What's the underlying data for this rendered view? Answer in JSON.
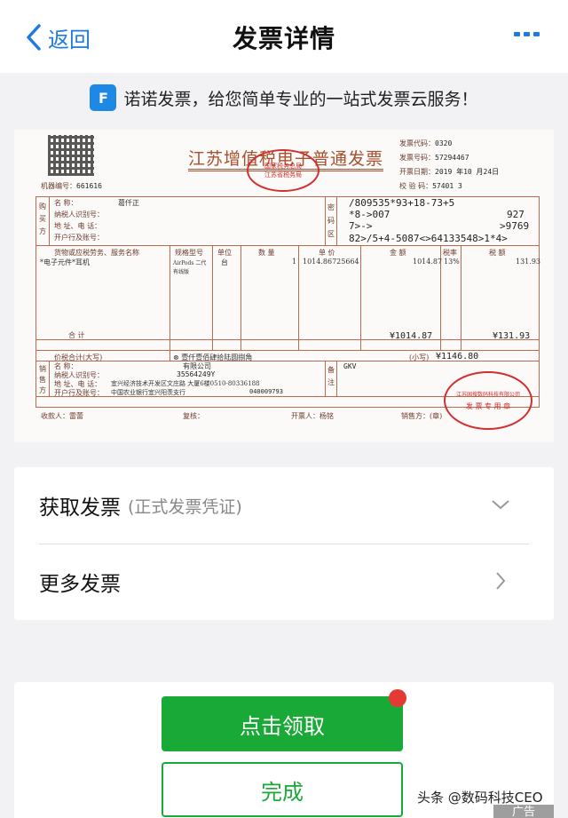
{
  "nav": {
    "back_label": "返回",
    "title": "发票详情"
  },
  "banner": {
    "logo_text": "F",
    "text": "诺诺发票，给您简单专业的一站式发票云服务！"
  },
  "invoice": {
    "title": "江苏增值税电子普通发票",
    "machine_no_label": "机器编号：",
    "machine_no": "661616",
    "invoice_code_label": "发票代码：",
    "invoice_code": "0320",
    "invoice_no_label": "发票号码：",
    "invoice_no": "57294467",
    "issue_date_label": "开票日期：",
    "issue_date": "2019 年10 月24日",
    "check_code_label": "校 验 码：",
    "check_code": "57401 3",
    "stamp_top": "国家税务总局",
    "stamp_bottom": "江苏省税务局",
    "buyer_side": "购买方",
    "buyer_fields": [
      "名      称：",
      "纳税人识别号：",
      "地 址、电 话：",
      "开户行及账号："
    ],
    "buyer_name": "葛仟正",
    "cipher_side": "密码区",
    "cipher_lines": [
      "/809535*93+18-73+5",
      "*8->007",
      "7>->",
      "82>/5+4-5087<>64133548>1*4>"
    ],
    "cipher_right": [
      "927",
      ">9769"
    ],
    "col_headers": [
      "货物或应税劳务、服务名称",
      "规格型号",
      "单位",
      "数 量",
      "单 价",
      "金 额",
      "税率",
      "税 额"
    ],
    "item_name": "*电子元件*耳机",
    "item_spec": "AirPods 二代 有线版",
    "item_unit": "台",
    "item_qty": "1",
    "item_price": "1014.86725664",
    "item_amount": "1014.87",
    "item_rate": "13%",
    "item_tax": "131.93",
    "total_label": "合      计",
    "total_amount": "¥1014.87",
    "total_tax": "¥131.93",
    "grand_label": "价税合计(大写)",
    "grand_words": "壹仟壹佰肆拾陆圆捌角",
    "grand_small_label": "(小写)",
    "grand_value": "¥1146.80",
    "seller_side": "销售方",
    "seller_fields": [
      "名      称：",
      "纳税人识别号：",
      "地 址、电 话：",
      "开户行及账号："
    ],
    "seller_name": "有限公司",
    "seller_tax_id": "35564249Y",
    "seller_address": "宜兴经济技术开发区文庄路 大厦6楼0510-80336188",
    "seller_bank": "中国农业银行宜兴阳羡支行",
    "seller_bank_no": "040009793",
    "remark_side": "备注",
    "remark": "GKV",
    "payee_label": "收款人：",
    "payee": "雷蕾",
    "reviewer_label": "复核：",
    "drawer_label": "开票人：",
    "drawer": "杨铭",
    "seller_sign_label": "销售方：(章)",
    "seller_stamp_text": "江苏国搜数码科技有限公司",
    "seller_stamp_bottom": "发 票 专 用 章"
  },
  "card": {
    "get_invoice_label": "获取发票",
    "get_invoice_sub": "(正式发票凭证)",
    "more_invoice_label": "更多发票"
  },
  "actions": {
    "claim_label": "点击领取",
    "done_label": "完成"
  },
  "footer": {
    "watermark": "头条 @数码科技CEO",
    "ad_label": "广告"
  },
  "colors": {
    "accent_blue": "#1e7be2",
    "primary_green": "#19a937",
    "badge_red": "#e53935",
    "invoice_brown": "#a8502e"
  }
}
